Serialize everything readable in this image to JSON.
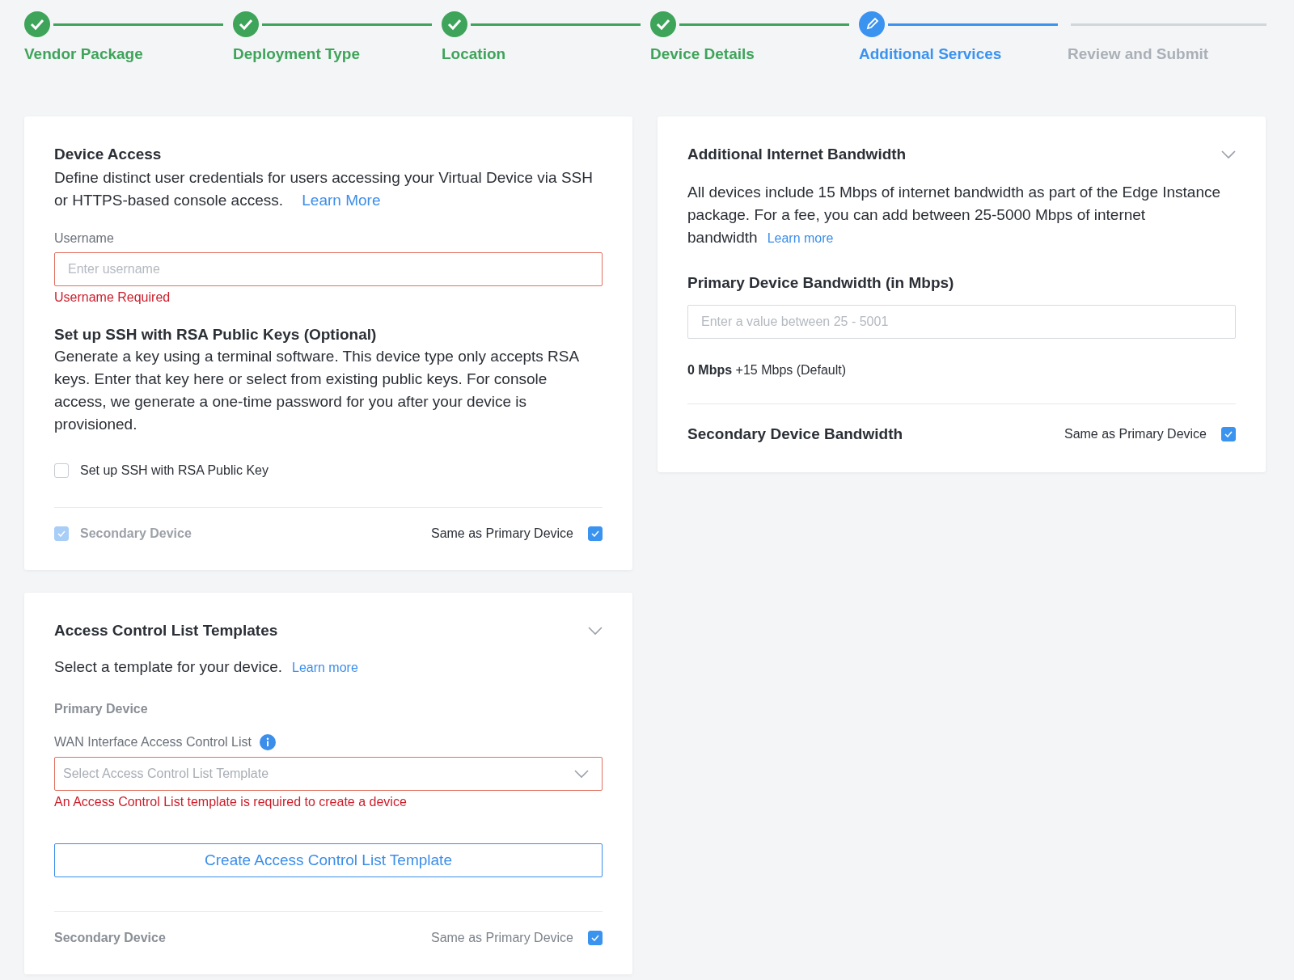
{
  "stepper": [
    {
      "label": "Vendor Package",
      "completed": true,
      "selected": false
    },
    {
      "label": "Deployment Type",
      "completed": true,
      "selected": false
    },
    {
      "label": "Location",
      "completed": true,
      "selected": false
    },
    {
      "label": "Device Details",
      "completed": true,
      "selected": false
    },
    {
      "label": "Additional Services",
      "completed": false,
      "selected": true
    },
    {
      "label": "Review and Submit",
      "completed": false,
      "selected": false
    }
  ],
  "device_access": {
    "title": "Device Access",
    "description": "Define distinct user credentials for users accessing your Virtual Device via SSH or HTTPS-based console access.",
    "learn_more": "Learn More",
    "username": {
      "label": "Username",
      "placeholder": "Enter username",
      "error": "Username Required"
    },
    "ssh": {
      "title": "Set up SSH with RSA Public Keys (Optional)",
      "description": "Generate a key using a terminal software. This device type only accepts RSA keys. Enter that key here or select from existing public keys. For console access, we generate a one-time password for you after your device is provisioned.",
      "checkbox": {
        "label": "Set up SSH with RSA Public Key",
        "checked": false
      }
    },
    "secondary": {
      "label": "Secondary Device",
      "checked": true,
      "disabled": true,
      "same_as": {
        "label": "Same as Primary Device",
        "checked": true
      }
    }
  },
  "acl": {
    "title": "Access Control List Templates",
    "description": "Select a template for your device.",
    "learn_more": "Learn more",
    "primary_label": "Primary Device",
    "wan": {
      "label": "WAN Interface Access Control List",
      "placeholder": "Select Access Control List Template",
      "error": "An Access Control List template is required to create a device"
    },
    "create_button": "Create Access Control List Template",
    "secondary": {
      "label": "Secondary Device",
      "same_as": {
        "label": "Same as Primary Device",
        "checked": true
      }
    }
  },
  "bandwidth": {
    "title": "Additional Internet Bandwidth",
    "description": "All devices include 15 Mbps of internet bandwidth as part of the Edge Instance package. For a fee, you can add between 25-5000 Mbps of internet bandwidth",
    "learn_more": "Learn more",
    "primary_title": "Primary Device Bandwidth (in Mbps)",
    "placeholder": "Enter a value between 25 - 5001",
    "summary": "**0 Mbps** +15 Mbps (Default)",
    "secondary_title": "Secondary Device Bandwidth",
    "same_as": {
      "label": "Same as Primary Device",
      "checked": true
    }
  }
}
